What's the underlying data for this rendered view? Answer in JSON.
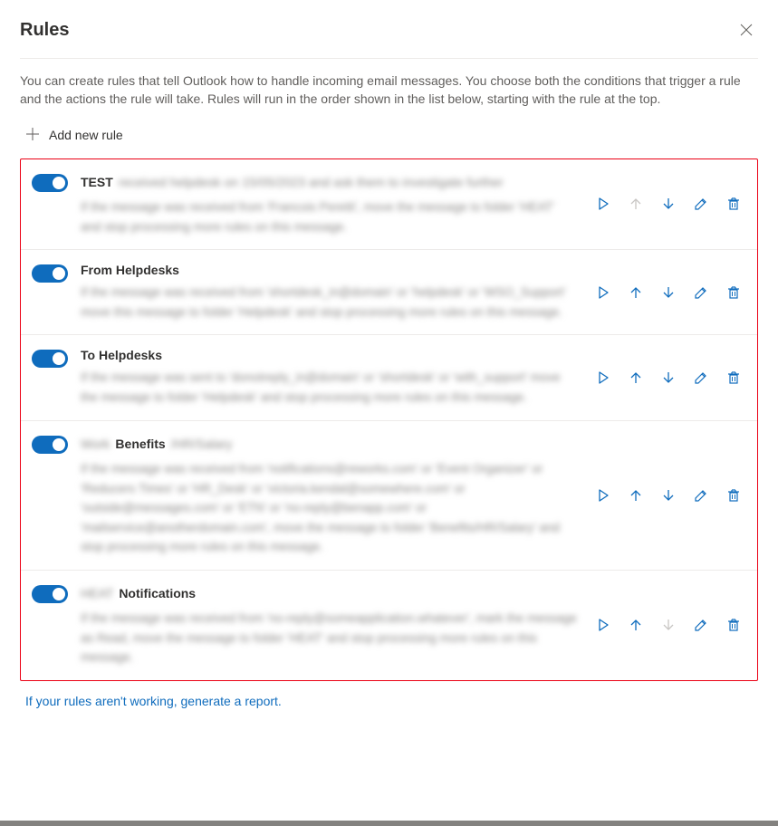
{
  "header": {
    "title": "Rules"
  },
  "intro": "You can create rules that tell Outlook how to handle incoming email messages. You choose both the conditions that trigger a rule and the actions the rule will take. Rules will run in the order shown in the list below, starting with the rule at the top.",
  "addNewLabel": "Add new rule",
  "rules": [
    {
      "name": "TEST",
      "titleObscured": "received helpdesk on 15/05/2023 and ask them to investigate further",
      "descObscured": "If the message was received from 'Francois Peretti', move the message to folder 'HEAT' and stop processing more rules on this message.",
      "upDisabled": true,
      "downDisabled": false
    },
    {
      "name": "From Helpdesks",
      "titleObscured": "",
      "descObscured": "If the message was received from 'shortdesk_in@domain' or 'helpdesk' or 'WSO_Support' move this message to folder 'Helpdesk' and stop processing more rules on this message.",
      "upDisabled": false,
      "downDisabled": false
    },
    {
      "name": "To Helpdesks",
      "titleObscured": "",
      "descObscured": "If the message was sent to 'donotreply_in@domain' or 'shortdesk' or 'with_support' move the message to folder 'Helpdesk' and stop processing more rules on this message.",
      "upDisabled": false,
      "downDisabled": false
    },
    {
      "name": "Benefits",
      "namePrefixObscured": "Work",
      "nameSuffixObscured": "/HR/Salary",
      "titleObscured": "",
      "descObscured": "If the message was received from 'notifications@reworks.com' or 'Event Organizer' or 'Reducers Times' or 'HR_Desk' or 'victoria.kendal@somewhere.com' or 'outside@messages.com' or 'ETN' or 'no-reply@benapp.com' or 'mailservice@anotherdomain.com', move the message to folder 'Benefits/HR/Salary' and stop processing more rules on this message.",
      "upDisabled": false,
      "downDisabled": false
    },
    {
      "name": "Notifications",
      "namePrefixObscured": "HEAT",
      "titleObscured": "",
      "descObscured": "If the message was received from 'no-reply@someapplication.whatever', mark the message as Read, move the message to folder 'HEAT' and stop processing more rules on this message.",
      "upDisabled": false,
      "downDisabled": true
    }
  ],
  "reportLink": "If your rules aren't working, generate a report."
}
